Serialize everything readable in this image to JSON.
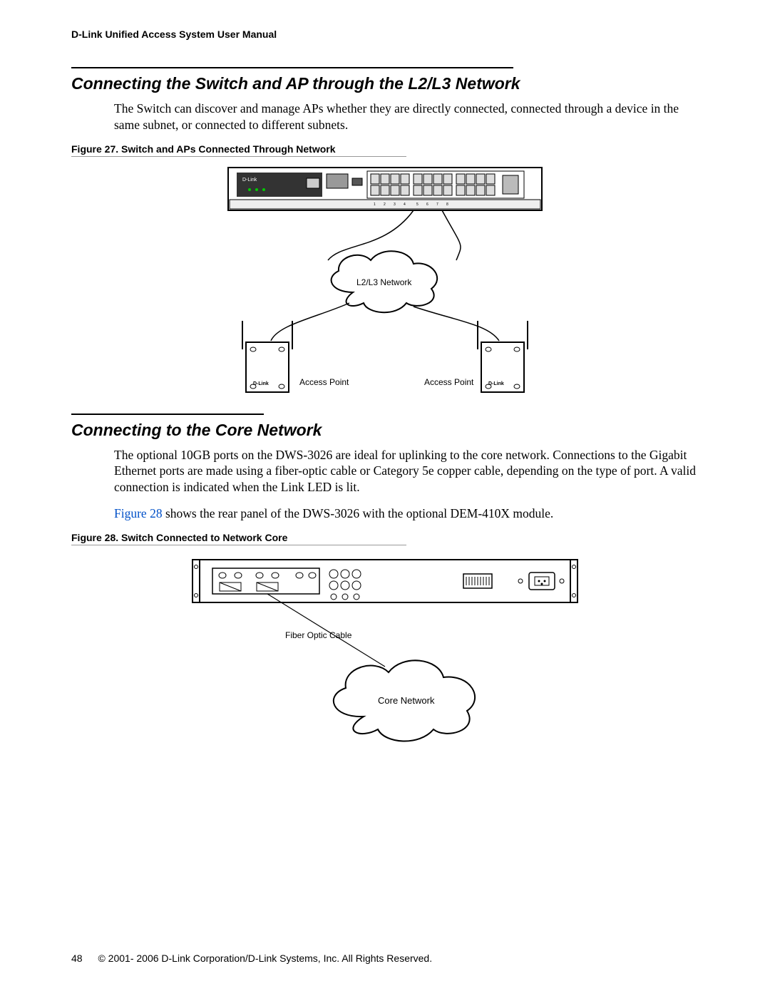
{
  "header": "D-Link Unified Access System User Manual",
  "section1": {
    "title": "Connecting the Switch and AP through the L2/L3 Network",
    "para": "The Switch can discover and manage APs whether they are directly connected, connected through a device in the same subnet, or connected to different subnets.",
    "figure_label": "Figure 27.  Switch and APs Connected Through Network",
    "diagram": {
      "network_label": "L2/L3 Network",
      "ap_left": "Access Point",
      "ap_right": "Access Point",
      "brand": "D-Link"
    }
  },
  "section2": {
    "title": "Connecting to the Core Network",
    "para1": "The optional 10GB ports on the DWS-3026 are ideal for uplinking to the core network. Connections to the Gigabit Ethernet ports are made using a fiber-optic cable or Category 5e copper cable, depending on the type of port. A valid connection is indicated when the Link LED is lit.",
    "para2_prefix": "Figure 28",
    "para2_rest": " shows the rear panel of the DWS-3026 with the optional DEM-410X module.",
    "figure_label": "Figure 28.  Switch Connected to Network Core",
    "diagram": {
      "cable_label": "Fiber Optic Cable",
      "network_label": "Core Network"
    }
  },
  "footer": {
    "page": "48",
    "copyright": "© 2001- 2006 D-Link Corporation/D-Link Systems, Inc. All Rights Reserved."
  }
}
